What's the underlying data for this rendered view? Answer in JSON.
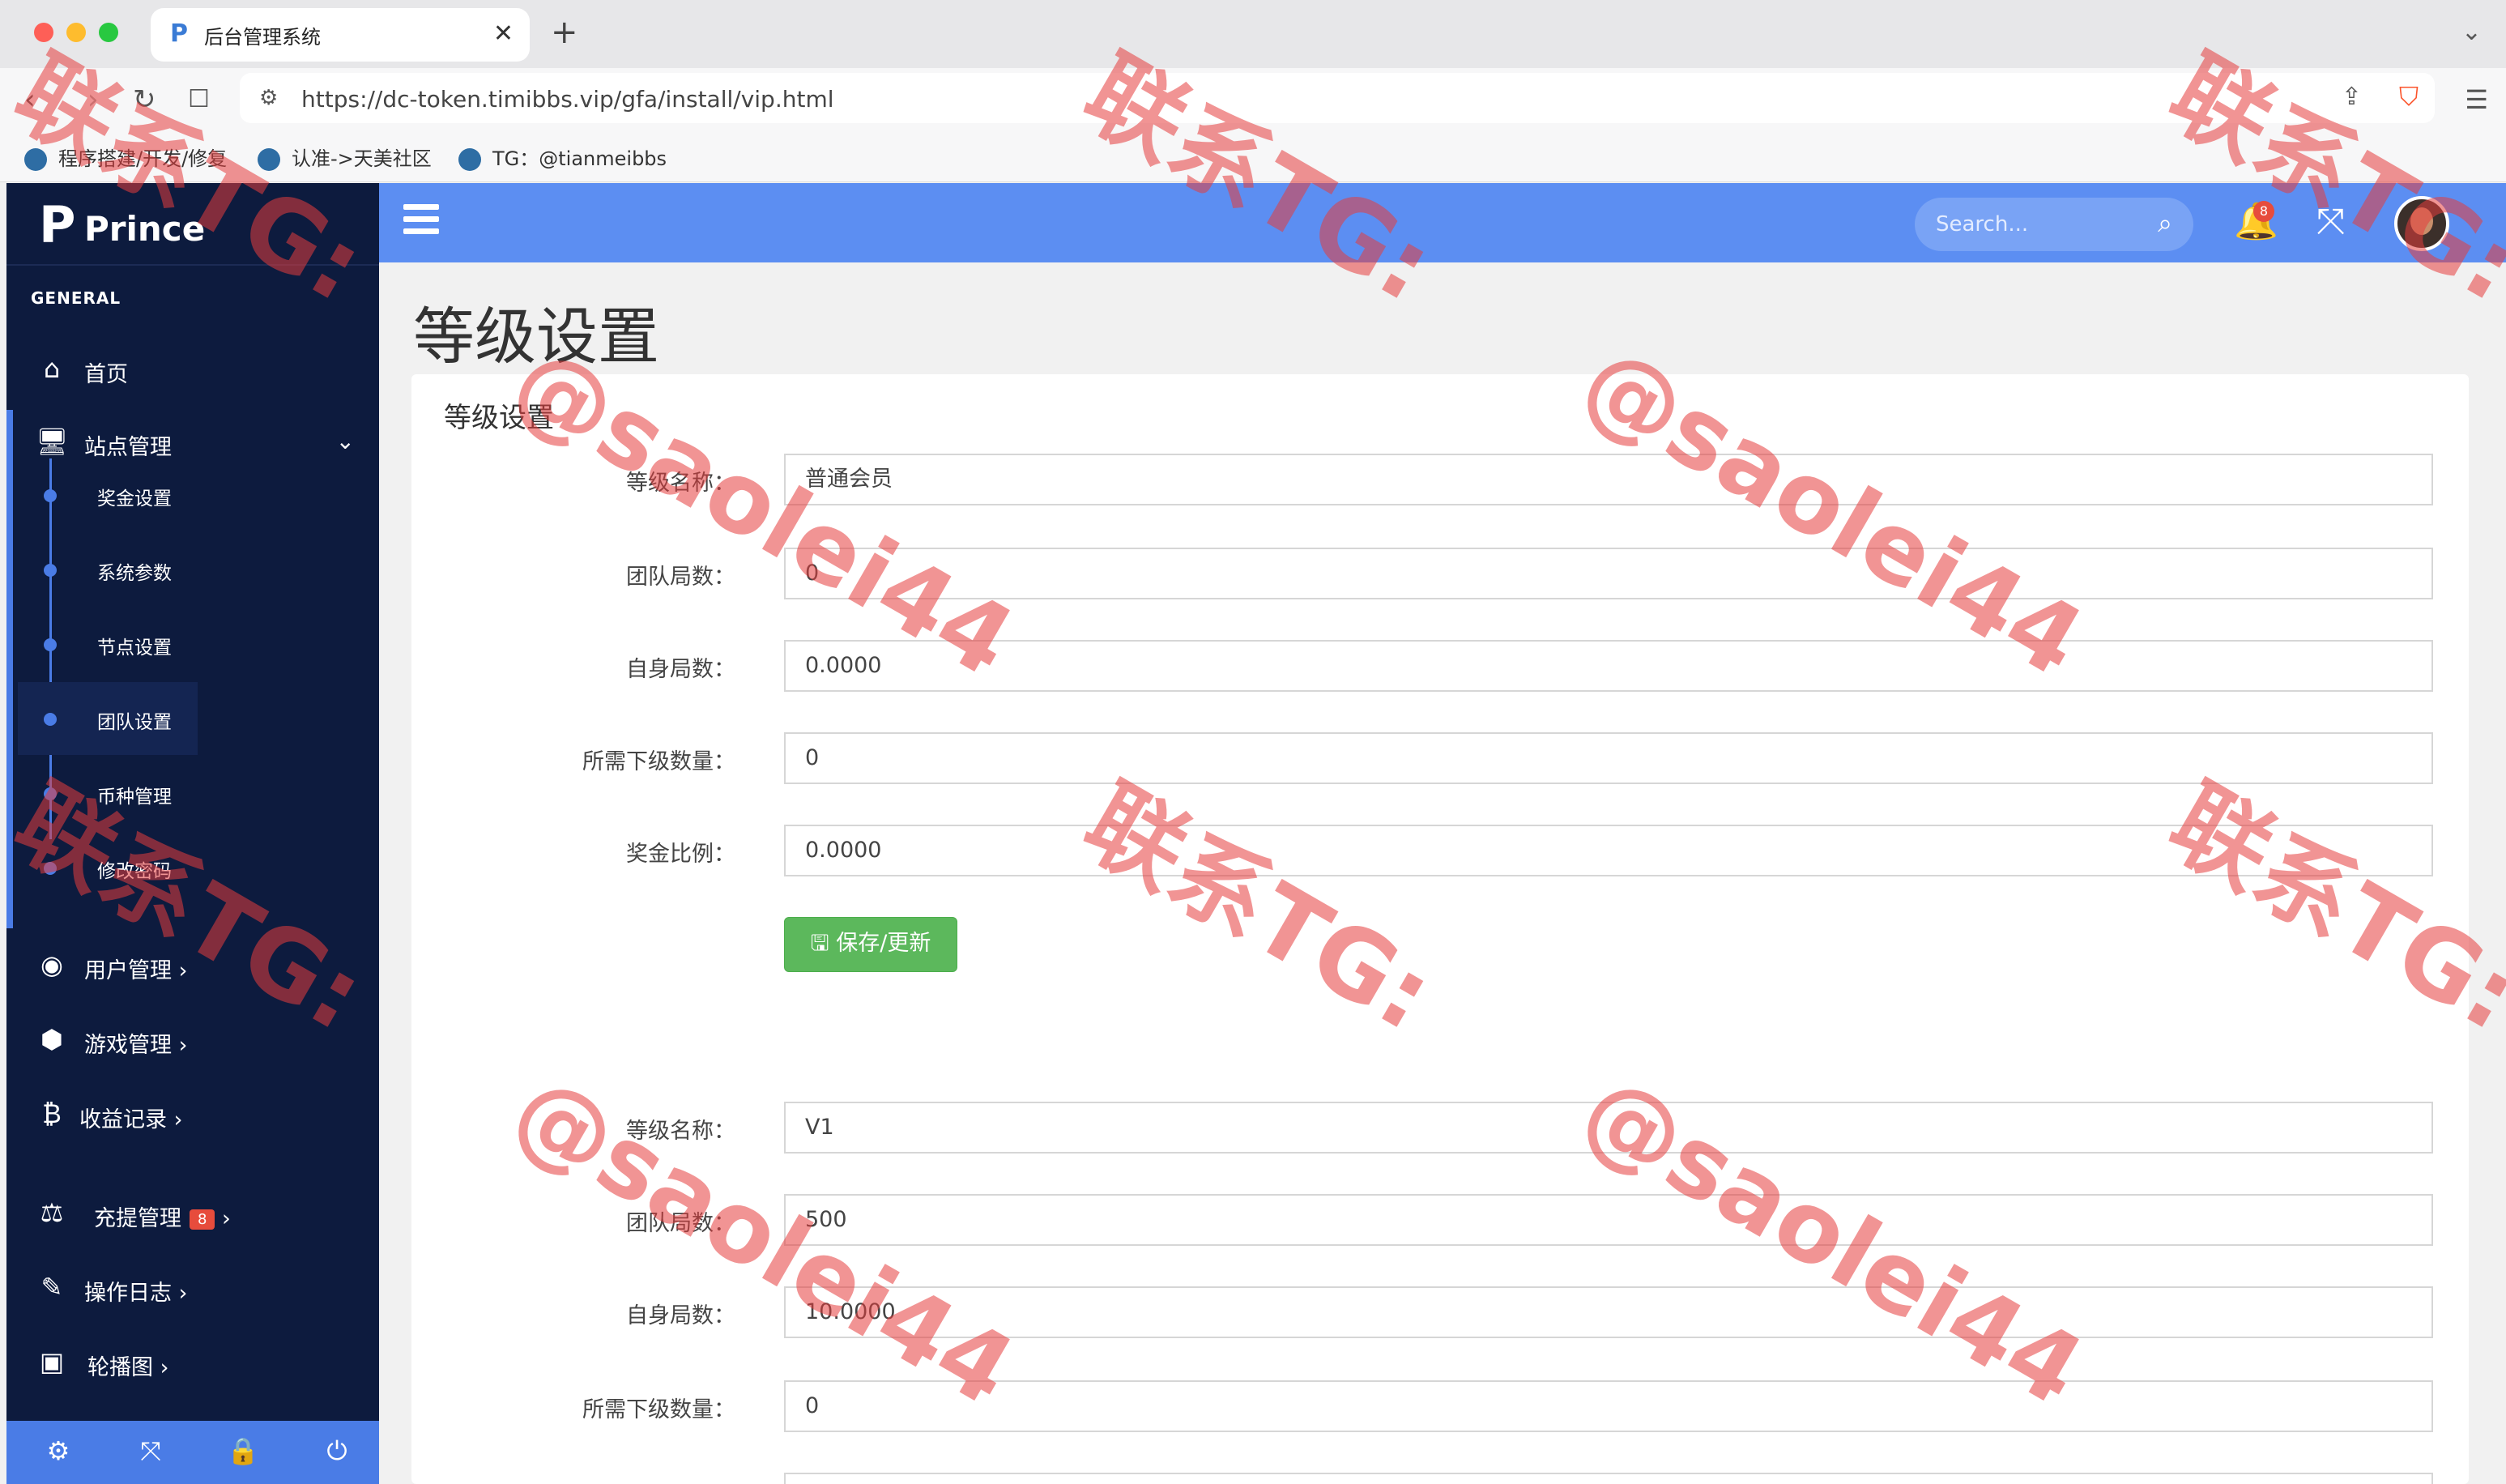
{
  "browser": {
    "tab_title": "后台管理系统",
    "tab_favicon": "P",
    "url": "https://dc-token.timibbs.vip/gfa/install/vip.html",
    "bookmarks": [
      "程序搭建/开发/修复",
      "认准->天美社区",
      "TG：@tianmeibbs"
    ]
  },
  "brand": {
    "logo": "P",
    "name": "Prince"
  },
  "sidebar": {
    "section": "GENERAL",
    "items": [
      {
        "icon": "home-icon",
        "label": "首页"
      },
      {
        "icon": "monitor-icon",
        "label": "站点管理",
        "expanded": true,
        "children": [
          "奖金设置",
          "系统参数",
          "节点设置",
          "团队设置",
          "币种管理",
          "修改密码"
        ],
        "active_child": "团队设置"
      },
      {
        "icon": "user-circle-icon",
        "label": "用户管理"
      },
      {
        "icon": "cube-icon",
        "label": "游戏管理"
      },
      {
        "icon": "bitcoin-icon",
        "label": "收益记录"
      },
      {
        "icon": "balance-scale-icon",
        "label": "充提管理",
        "badge": "8"
      },
      {
        "icon": "edit-icon",
        "label": "操作日志"
      },
      {
        "icon": "image-icon",
        "label": "轮播图"
      }
    ],
    "footer_icons": [
      "settings-icon",
      "fullscreen-icon",
      "lock-icon",
      "power-icon"
    ]
  },
  "topbar": {
    "search_placeholder": "Search...",
    "notification_count": "8"
  },
  "page": {
    "title": "等级设置",
    "panel_title": "等级设置",
    "labels": {
      "level_name": "等级名称：",
      "team_rounds": "团队局数：",
      "self_rounds": "自身局数：",
      "sub_count": "所需下级数量：",
      "bonus_ratio": "奖金比例："
    },
    "save_label": "保存/更新",
    "levels": [
      {
        "level_name": "普通会员",
        "team_rounds": "0",
        "self_rounds": "0.0000",
        "sub_count": "0",
        "bonus_ratio": "0.0000"
      },
      {
        "level_name": "V1",
        "team_rounds": "500",
        "self_rounds": "10.0000",
        "sub_count": "0"
      }
    ]
  },
  "watermark": {
    "line1": "联系TG:",
    "line2": "@saolei44"
  },
  "colors": {
    "sidebar": "#0d1b3e",
    "topbar": "#5c8ef2",
    "accent": "#4a7ce6",
    "save": "#5cb85c",
    "badge": "#e74c3c"
  }
}
